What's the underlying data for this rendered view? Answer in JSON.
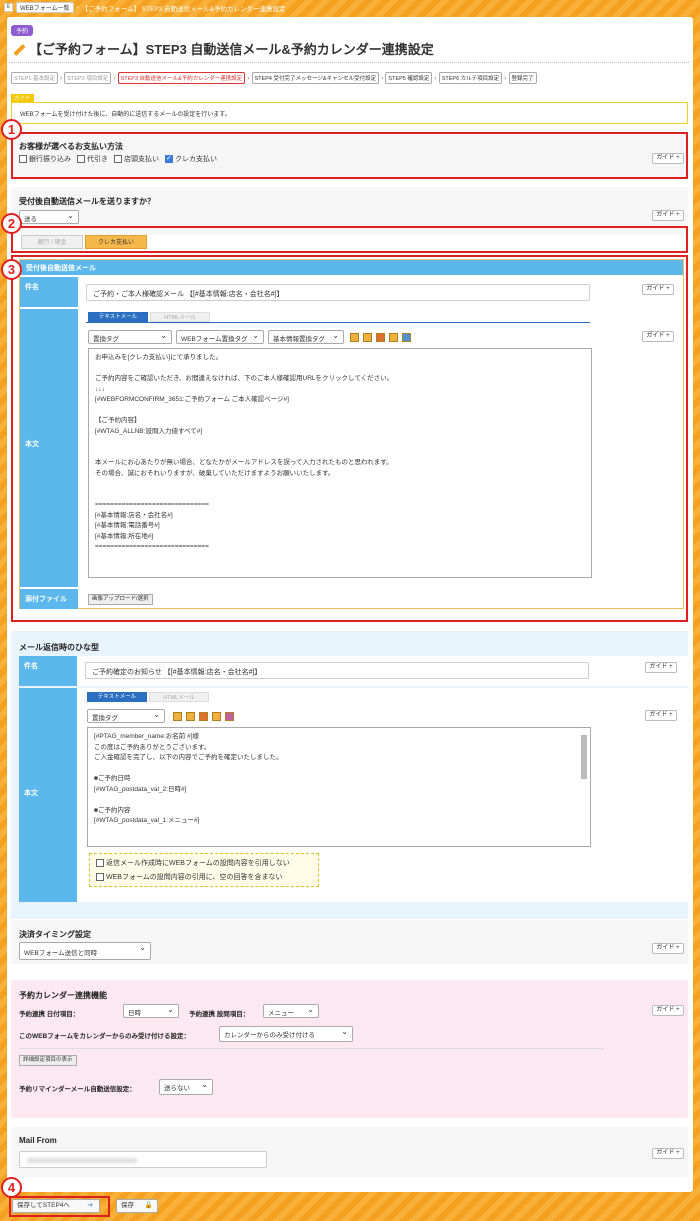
{
  "topbar": {
    "home": "E",
    "crumb1": "WEBフォーム一覧",
    "crumb2": "【ご予約フォーム】 STEP3 自動送信メール&予約カレンダー連携設定"
  },
  "tag": "予約",
  "title": "【ご予約フォーム】STEP3 自動送信メール&予約カレンダー連携設定",
  "steps": [
    "STEP1 基本設定",
    "STEP2 項目設定",
    "STEP3 自動送信メール&予約カレンダー連携設定",
    "STEP4 受付完了メッセージ&キャンセル受付設定",
    "STEP5 確認設定",
    "STEP6 カルテ項目設定",
    "登録完了"
  ],
  "guide_tag": "ガイド",
  "guide_text": "WEBフォームを受け付けた後に、自動的に送信するメールの設定を行います。",
  "guide_btn": "ガイド +",
  "callouts": [
    "1",
    "2",
    "3",
    "4"
  ],
  "pay": {
    "title": "お客様が選べるお支払い方法",
    "opts": [
      "銀行振り込み",
      "代引き",
      "店頭支払い",
      "クレカ支払い"
    ]
  },
  "auto": {
    "title": "受付後自動送信メールを送りますか？",
    "value": "送る",
    "tabs": [
      "銀行 / 現金",
      "クレカ支払い"
    ]
  },
  "mail1": {
    "header": "受付後自動送信メール",
    "subject_label": "件名",
    "subject": "ご予約・ご本人様確認メール 【[#基本情報:店名・会社名#]】",
    "tabs": [
      "テキストメール",
      "HTMLメール"
    ],
    "sels": [
      "置換タグ",
      "WEBフォーム置換タグ",
      "基本情報置換タグ"
    ],
    "body_label": "本文",
    "body": "お申込みを[クレカ支払い]にて承りました。\n\nご予約内容をご確認いただき、お間違えなければ、下のご本人様確認用URLをクリックしてください。\n↓↓↓\n[#WEBFORMCONFIRM_3651:ご予約フォーム ご本人確認ページ#]\n\n【ご予約内容】\n[#WTAG_ALLNB:設問入力値すべて#]\n\n\n本メールにお心あたりが無い場合、どなたかがメールアドレスを誤って入力されたものと思われます。\nその場合、誠におそれいりますが、破棄していただけますようお願いいたします。\n\n\n==============================\n[#基本情報:店名・会社名#]\n[#基本情報:電話番号#]\n[#基本情報:所在地#]\n==============================",
    "attach_label": "添付ファイル",
    "attach_btn": "画像アップロード/選択"
  },
  "mail2": {
    "title": "メール返信時のひな型",
    "subject_label": "件名",
    "subject": "ご予約確定のお知らせ 【[#基本情報:店名・会社名#]】",
    "tabs": [
      "テキストメール",
      "HTMLメール"
    ],
    "sel": "置換タグ",
    "body_label": "本文",
    "body": "[#PTAG_member_name:お名前 #]様\nこの度はご予約ありがとうございます。\nご入金確認を完了し、以下の内容でご予約を確定いたしました。\n\n■ご予約日時\n[#WTAG_postdata_val_2:日時#]\n\n■ご予約内容\n[#WTAG_postdata_val_1:メニュー#]\n\n",
    "checks": [
      "返信メール作成時にWEBフォームの設問内容を引用しない",
      "WEBフォームの設問内容の引用に、空の回答を含まない"
    ]
  },
  "timing": {
    "title": "決済タイミング設定",
    "value": "WEBフォーム送信と同時"
  },
  "cal": {
    "title": "予約カレンダー連携機能",
    "date_label": "予約連携 日付項目：",
    "date_val": "日時",
    "q_label": "予約連携 設問項目：",
    "q_val": "メニュー",
    "only_label": "このWEBフォームをカレンダーからのみ受け付ける設定：",
    "only_val": "カレンダーからのみ受け付ける",
    "detail_btn": "詳細設定項目の表示",
    "remind_label": "予約リマインダーメール自動送信設定：",
    "remind_val": "送らない"
  },
  "mailfrom": {
    "title": "Mail From"
  },
  "footer": {
    "next": "保存してSTEP4へ",
    "save": "保存"
  },
  "colors": {
    "accent": "#f4a020",
    "label_blue": "#5cb8ec",
    "callout": "#e02020"
  }
}
